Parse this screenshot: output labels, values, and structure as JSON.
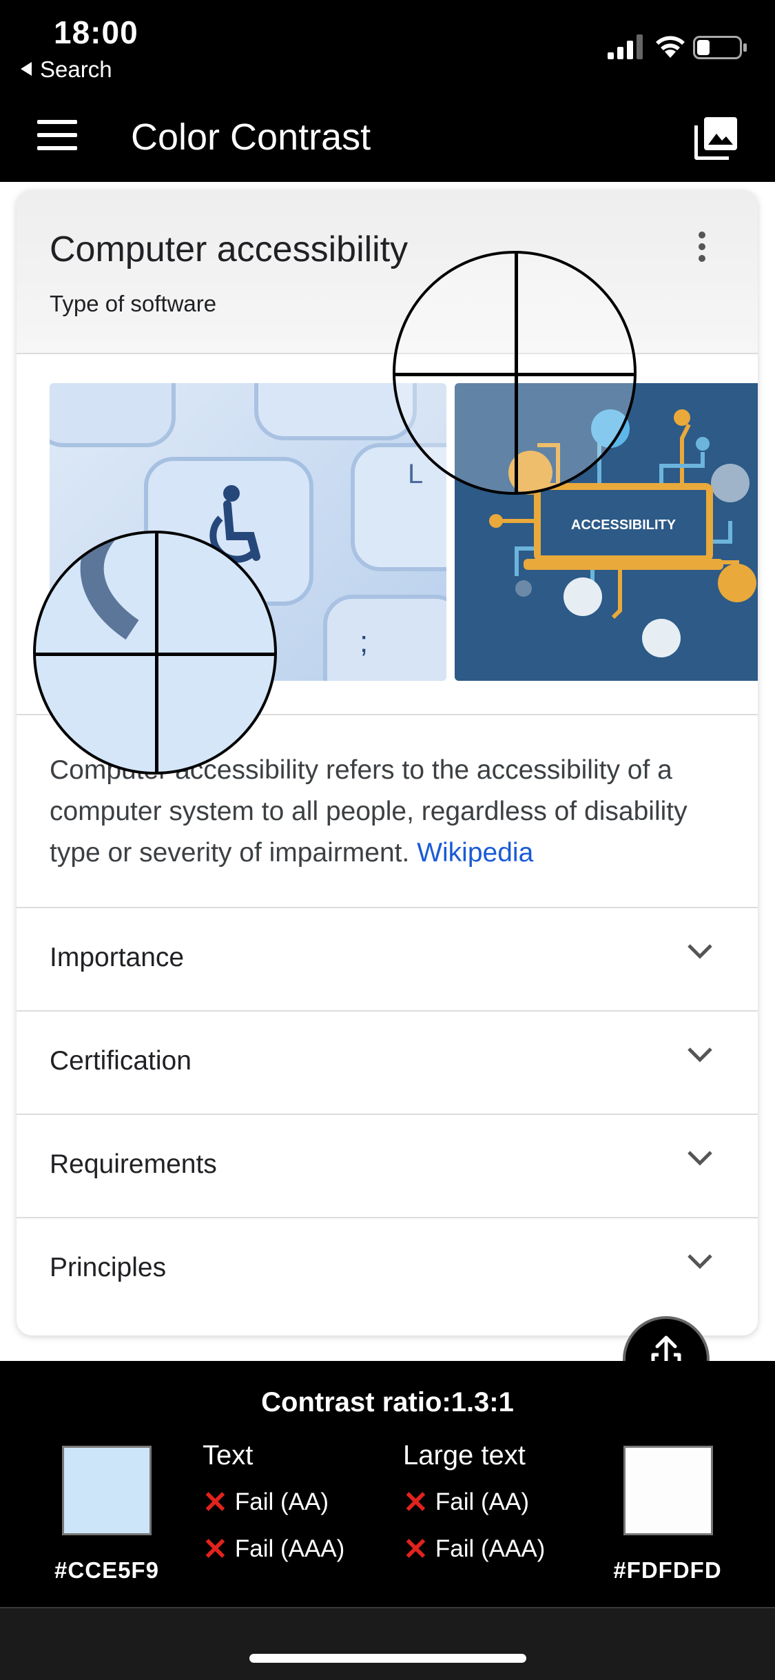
{
  "status_bar": {
    "time": "18:00",
    "back_label": "Search"
  },
  "app_bar": {
    "title": "Color Contrast",
    "menu_icon": "hamburger-menu-icon",
    "image_icon": "photo-library-icon"
  },
  "card": {
    "title": "Computer accessibility",
    "subtitle": "Type of software",
    "description": "Computer accessibility refers to the accessibility of a computer system to all people, regardless of disability type or severity of impairment.",
    "link_text": "Wikipedia",
    "sections": [
      {
        "label": "Importance"
      },
      {
        "label": "Certification"
      },
      {
        "label": "Requirements"
      },
      {
        "label": "Principles"
      }
    ],
    "image2_text": "ACCESSIBILITY"
  },
  "contrast": {
    "ratio_text": "Contrast ratio:1.3:1",
    "color1": "#CCE5F9",
    "color2": "#FDFDFD",
    "text": {
      "title": "Text",
      "aa": "Fail (AA)",
      "aaa": "Fail (AAA)"
    },
    "large_text": {
      "title": "Large text",
      "aa": "Fail (AA)",
      "aaa": "Fail (AAA)"
    }
  }
}
